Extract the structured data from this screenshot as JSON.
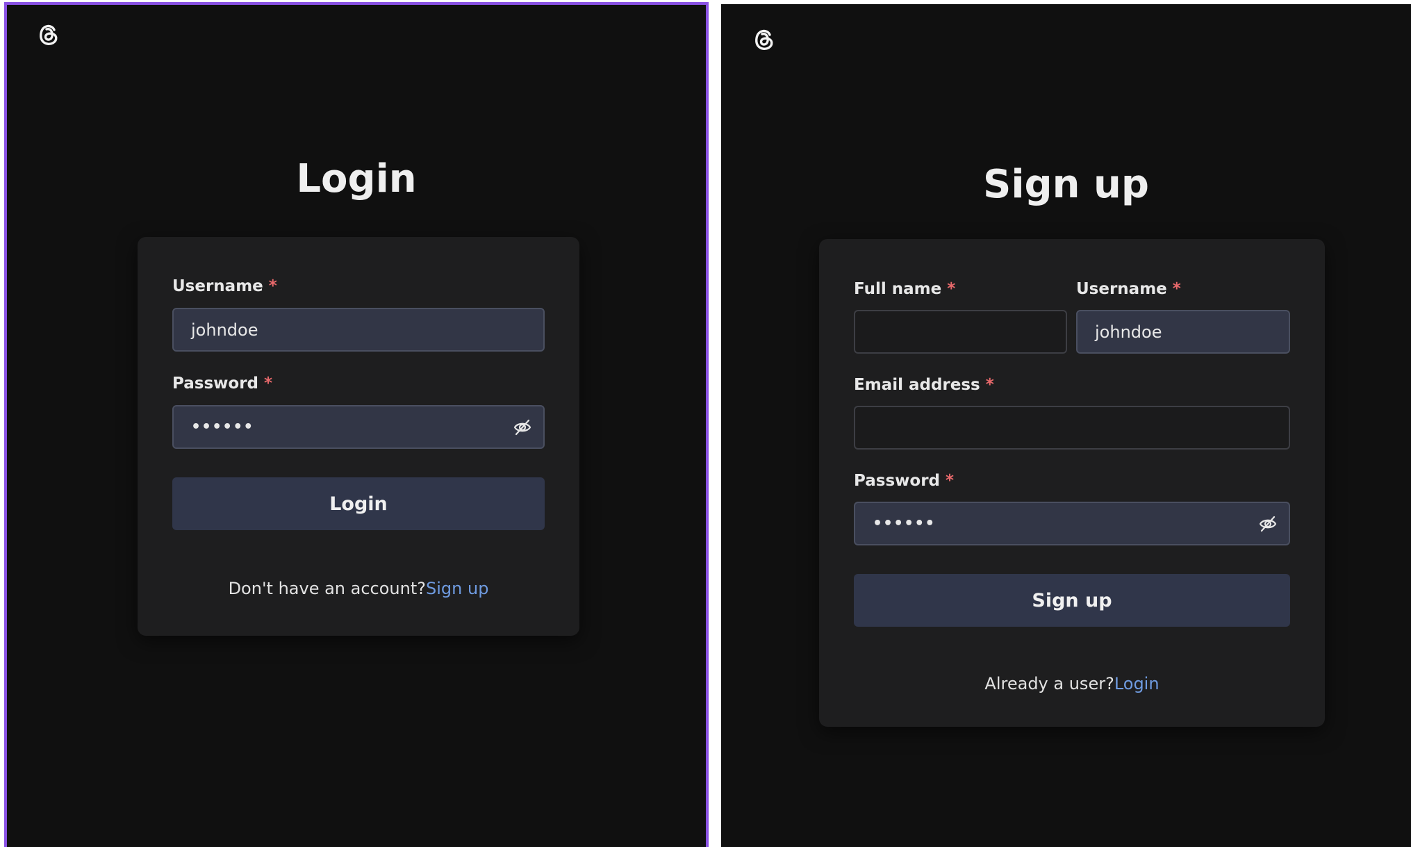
{
  "login": {
    "title": "Login",
    "username": {
      "label": "Username",
      "required": "*",
      "value": "johndoe"
    },
    "password": {
      "label": "Password",
      "required": "*",
      "value": "••••••"
    },
    "submit_label": "Login",
    "footer_text": "Don't have an account?",
    "footer_link": "Sign up"
  },
  "signup": {
    "title": "Sign up",
    "fullname": {
      "label": "Full name",
      "required": "*",
      "value": ""
    },
    "username": {
      "label": "Username",
      "required": "*",
      "value": "johndoe"
    },
    "email": {
      "label": "Email address",
      "required": "*",
      "value": ""
    },
    "password": {
      "label": "Password",
      "required": "*",
      "value": "••••••"
    },
    "submit_label": "Sign up",
    "footer_text": "Already a user?",
    "footer_link": "Login"
  },
  "icons": {
    "logo": "threads-logo-icon",
    "password_toggle": "eye-slash-icon"
  },
  "colors": {
    "background": "#101010",
    "card": "#1e1e1f",
    "input_filled": "#323646",
    "button": "#30364a",
    "link": "#6f9be0",
    "required": "#e8696b",
    "selection_border": "#8a52e4"
  }
}
